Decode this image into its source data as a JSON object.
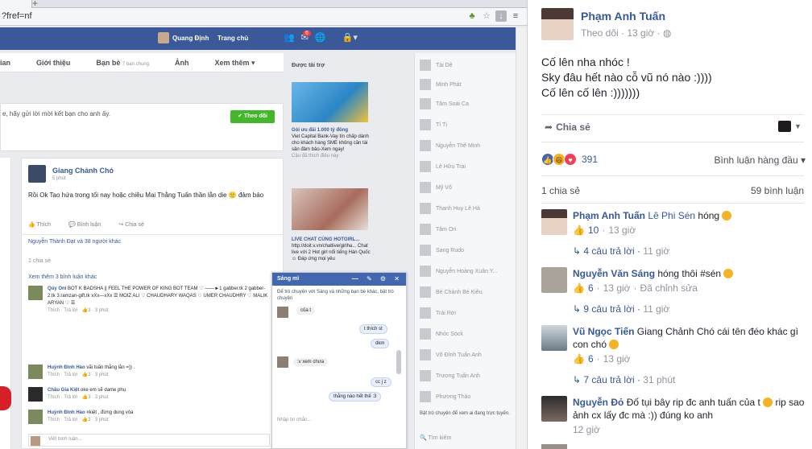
{
  "screenshot": {
    "browser": {
      "address": "?fref=nf",
      "new_tab": "+"
    },
    "topbar": {
      "user_name": "Quang Định",
      "home": "Trang chủ",
      "notif_count": "6"
    },
    "profile_nav": [
      {
        "label": "ian",
        "extra": ""
      },
      {
        "label": "Giới thiệu",
        "extra": ""
      },
      {
        "label": "Bạn bè",
        "extra": "7 bạn chung"
      },
      {
        "label": "Ảnh",
        "extra": ""
      },
      {
        "label": "Xem thêm ▾",
        "extra": ""
      }
    ],
    "friend_hint": "e, hãy gửi lời mời kết bạn cho anh ấy.",
    "follow_label": "Theo dõi",
    "post": {
      "author": "Giang Chảnh Chó",
      "time": "5 phút",
      "body": "Rồi Ok Tao hứa trong tối nay hoặc chiều Mai Thằng Tuấn thần lằn die 🙂 đảm bảo",
      "actions": [
        "Thích",
        "Bình luận",
        "Chia sẻ"
      ],
      "likes": "Nguyễn Thành Đạt và 38 người khác",
      "shares": "1 chia sẻ",
      "more_comments": "Xem thêm 3 bình luận khác",
      "comments": [
        {
          "name": "Qúy Oni",
          "text": "BOT K BADSHA || FEEL THE POWER OF KING BOT TEAM ♡ ——►1 gabber.tk 2 gabber-2.tk 3.ramzan-gift.tk xXx—xXx ☰ MOIZ ALI ♡ CHAUDHARY WAQAS ♡ UMER CHAUDHRY ♡ MALIK ARYAN ♡ ☰",
          "meta": "Thích · Trả lời · 👍3 · 3 phút"
        },
        {
          "name": "Huỳnh Đình Hào",
          "text": "vãi tuấn thằng lằn =)) .",
          "meta": "Thích · Trả lời · 👍3 · 3 phút"
        },
        {
          "name": "Châu Gia Kiệt",
          "text": "oke em sẽ dame phụ",
          "meta": "Thích · Trả lời · 👍3 · 3 phút"
        },
        {
          "name": "Huỳnh Đình Hào",
          "text": "#kiệt , đừng dung vòa",
          "meta": "Thích · Trả lời · 👍3 · 3 phút"
        }
      ],
      "input_placeholder": "Viết bình luận..."
    },
    "ads": {
      "title": "Được tài trợ",
      "ad1_title": "Gói ưu đãi 1.000 tỷ đồng",
      "ad1_text": "Viet Capital Bank-Vay tín chấp dành cho khách hàng SME không cần tài sản đảm bảo-Xem ngay!",
      "ad1_sub": "Cậu đã thích điều này",
      "ad2_title": "LIVE CHAT CÙNG HOTGIRL...",
      "ad2_text": "http://doit.v.vn/chatlive/girlha... Chat live với 2 Hot girl nổi tiếng Hàn Quốc ☺ Đáp ứng mọi yêu"
    },
    "chat_contacts": [
      "Tài Dê",
      "Minh Phát",
      "Tâm Soái Ca",
      "Tí Tị",
      "Nguyễn Thế Minh",
      "Lê Hữu Trai",
      "Mỹ Võ",
      "Thanh Huy Lê Hà",
      "Tâm Ori",
      "Sang Rudo",
      "Nguyễn Hoàng Xuân Y...",
      "Bé Chảnh Bé Kiêu",
      "Trải Rời",
      "Nhóc Sock",
      "Võ Đình Tuấn Anh",
      "Trương Tuấn Anh",
      "Phương Thảo"
    ],
    "chat_notice": "Bật trò chuyện để xem ai đang trực tuyến.",
    "chat_search": "🔍 Tìm kiếm",
    "chat_window": {
      "title": "Sáng mì",
      "tools": "— ✎ ⚙ ✕",
      "intro": "Để trò chuyện với Sáng và những bạn bè khác, bật trò chuyện",
      "messages": [
        {
          "side": "in",
          "text": "của t"
        },
        {
          "side": "out",
          "text": "t thích st"
        },
        {
          "side": "out",
          "text": "dkm"
        },
        {
          "side": "in",
          "text": ":v xem chưa"
        },
        {
          "side": "out",
          "text": "cc j z"
        },
        {
          "side": "out",
          "text": "thằng nào hết thế :3"
        }
      ],
      "input_placeholder": "Nhập tin nhắn..."
    }
  },
  "panel": {
    "author": "Phạm Anh Tuấn",
    "follow": "Theo dõi",
    "time": "13 giờ",
    "privacy_icon": "globe-icon",
    "status": "Cố lên nha nhóc !\nSky đâu hết nào cỗ vũ nó nào :))))\nCố lên cố lên :)))))))",
    "share_action": "Chia sẻ",
    "reaction_count": "391",
    "sort_label": "Bình luận hàng đầu ▾",
    "shares": "1 chia sẻ",
    "comments_count": "59 bình luận",
    "comments": [
      {
        "name": "Phạm Anh Tuấn",
        "mention": "Lê Phi Sén",
        "text": " hóng ",
        "likes": "10",
        "time": "13 giờ",
        "edited": "",
        "replies": "4 câu trả lời",
        "reply_time": "11 giờ"
      },
      {
        "name": "Nguyễn Văn Sáng",
        "mention": "",
        "text": "hóng thôi #sén ",
        "likes": "6",
        "time": "13 giờ",
        "edited": "Đã chỉnh sửa",
        "replies": "9 câu trả lời",
        "reply_time": "11 giờ"
      },
      {
        "name": "Vũ Ngọc Tiến",
        "mention": "",
        "text": "Giang Chảnh Chó cái tên đéo khác gì con chó ",
        "likes": "6",
        "time": "13 giờ",
        "edited": "",
        "replies": "7 câu trả lời",
        "reply_time": "31 phút"
      },
      {
        "name": "Nguyễn Đỏ",
        "mention": "",
        "text": "Đố tụi bây rip đc anh tuấn của t ",
        "text2": " rip sao ảnh cx lấy đc mà :)) đúng ko anh",
        "likes": "",
        "time": "12 giờ",
        "edited": "",
        "replies": "",
        "reply_time": ""
      }
    ],
    "colors": {
      "link": "#365899",
      "like": "#4267b2",
      "haha": "#f7b125",
      "love": "#f33e58"
    }
  }
}
